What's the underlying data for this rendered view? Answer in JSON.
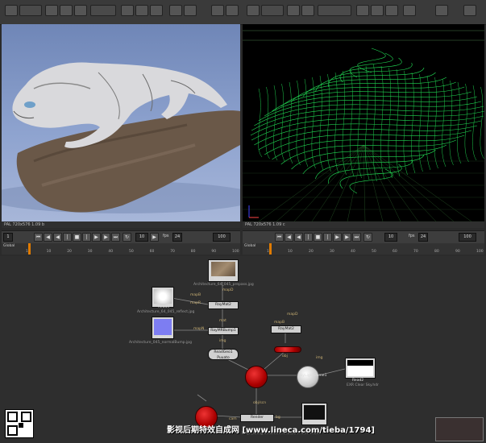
{
  "viewer_left": {
    "info": "PAL 720x576 1.09 b"
  },
  "viewer_right": {
    "info": "PAL 720x576 1.09 c"
  },
  "transport_left": {
    "start_frame": "1",
    "current_frame": "10",
    "fps_label": "fps",
    "fps_value": "24",
    "end_frame": "100",
    "range": "Global",
    "ticks": [
      "1",
      "10",
      "20",
      "30",
      "40",
      "50",
      "60",
      "70",
      "80",
      "90",
      "100"
    ]
  },
  "transport_right": {
    "current_frame": "10",
    "fps_label": "fps",
    "fps_value": "24",
    "end_frame": "100",
    "range": "Global",
    "ticks": [
      "1",
      "10",
      "20",
      "30",
      "40",
      "50",
      "60",
      "70",
      "80",
      "90",
      "100"
    ]
  },
  "nodes": {
    "read1": {
      "label": "Read1",
      "sub": "Architecture_64_045_prepass.jpg"
    },
    "read4": {
      "label": "Read4",
      "sub": "Architecture_64_045_reflect.jpg"
    },
    "read3": {
      "label": "Read3",
      "sub": "Architecture_045_normalBump.jpg"
    },
    "read2": {
      "label": "Read2",
      "sub": "EXR Clear Sky.hdr"
    },
    "read_geo": {
      "label": "ReadGeo1",
      "sub": "Puuato"
    },
    "raymat2": {
      "label": "RayMat2"
    },
    "raymat_bump": {
      "label": "RayMRBump1"
    },
    "raymat_b": {
      "label": "RayMat2"
    },
    "skylight": {
      "label": "SkyLightDome1"
    },
    "render": {
      "label": "Render"
    },
    "pipes": [
      "mapD",
      "mapB",
      "mapR",
      "mapN",
      "mat",
      "img",
      "mapD",
      "mapB",
      "obj",
      "img",
      "obj/scn",
      "cam",
      "bg"
    ]
  },
  "watermark": "影视后期特效自成网 [www.lineca.com/tieba/1794]",
  "url_faint": "http://blog.sina.com.cn/u/2479974420"
}
